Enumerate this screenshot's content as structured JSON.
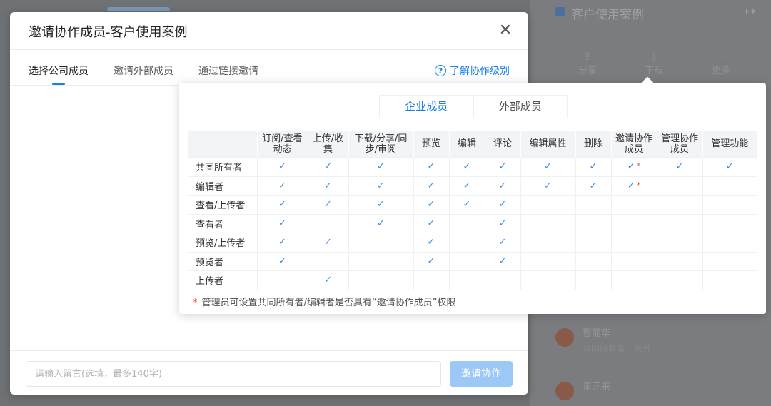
{
  "background": {
    "right_panel_title": "客户使用案例",
    "actions": [
      {
        "icon": "share-icon",
        "label": "分享"
      },
      {
        "icon": "download-icon",
        "label": "下载"
      },
      {
        "icon": "more-icon",
        "label": "更多"
      }
    ],
    "members": [
      {
        "name": "曹丽华",
        "sub": "共同所有者 · 未分"
      },
      {
        "name": "董元来",
        "sub": ""
      }
    ]
  },
  "dialog": {
    "title": "邀请协作成员-客户使用案例",
    "close_icon": "close-icon",
    "tabs": [
      {
        "label": "选择公司成员",
        "active": true
      },
      {
        "label": "邀请外部成员",
        "active": false
      },
      {
        "label": "通过链接邀请",
        "active": false
      }
    ],
    "help_link": "了解协作级别",
    "help_icon_glyph": "?",
    "message_placeholder": "请输入留言(选填，最多140字)",
    "invite_button": "邀请协作"
  },
  "popover": {
    "segments": [
      {
        "label": "企业成员",
        "active": true
      },
      {
        "label": "外部成员",
        "active": false
      }
    ],
    "columns": [
      "订阅/查看动态",
      "上传/收集",
      "下载/分享/同步/审阅",
      "预览",
      "编辑",
      "评论",
      "编辑属性",
      "删除",
      "邀请协作成员",
      "管理协作成员",
      "管理功能"
    ],
    "rows": [
      {
        "role": "共同所有者",
        "perms": [
          true,
          true,
          true,
          true,
          true,
          true,
          true,
          true,
          "star",
          true,
          true
        ]
      },
      {
        "role": "编辑者",
        "perms": [
          true,
          true,
          true,
          true,
          true,
          true,
          true,
          true,
          "star",
          false,
          false
        ]
      },
      {
        "role": "查看/上传者",
        "perms": [
          true,
          true,
          true,
          true,
          true,
          true,
          false,
          false,
          false,
          false,
          false
        ]
      },
      {
        "role": "查看者",
        "perms": [
          true,
          false,
          true,
          true,
          false,
          true,
          false,
          false,
          false,
          false,
          false
        ]
      },
      {
        "role": "预览/上传者",
        "perms": [
          true,
          true,
          false,
          true,
          false,
          true,
          false,
          false,
          false,
          false,
          false
        ]
      },
      {
        "role": "预览者",
        "perms": [
          true,
          false,
          false,
          true,
          false,
          true,
          false,
          false,
          false,
          false,
          false
        ]
      },
      {
        "role": "上传者",
        "perms": [
          false,
          true,
          false,
          false,
          false,
          false,
          false,
          false,
          false,
          false,
          false
        ]
      }
    ],
    "check_glyph": "✓",
    "star_glyph": "*",
    "note": "管理员可设置共同所有者/编辑者是否具有“邀请协作成员”权限",
    "colors": {
      "accent": "#1a7ee8",
      "check": "#3b8de6",
      "star": "#f04a3e"
    }
  }
}
